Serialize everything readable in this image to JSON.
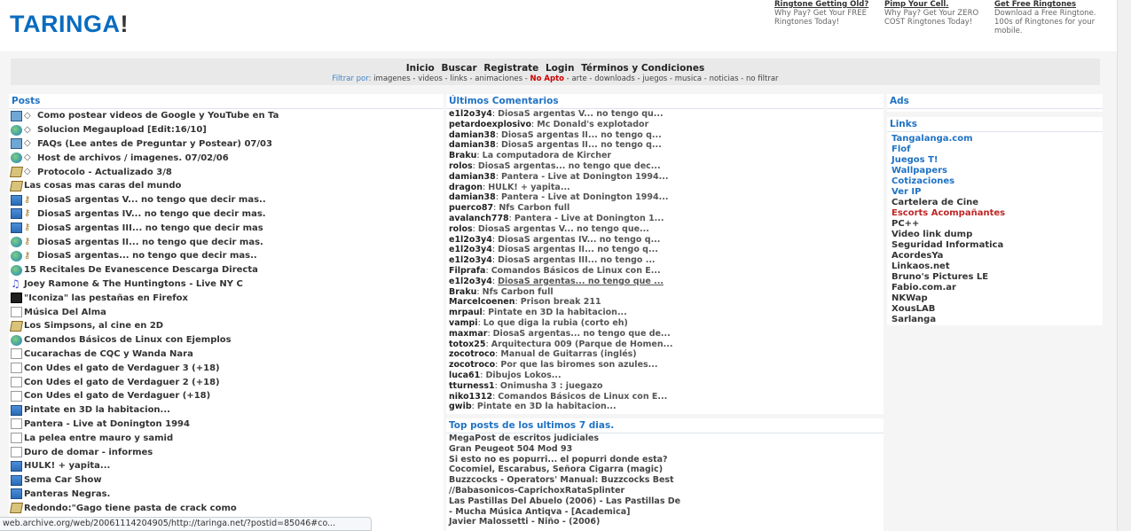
{
  "logo": {
    "text": "TARINGA",
    "bang": "!"
  },
  "top_ads": [
    {
      "title": "Ringtone Getting Old?",
      "desc1": "Why Pay? Get Your FREE",
      "desc2": "Ringtones Today!",
      "desc3": ""
    },
    {
      "title": "Pimp Your Cell.",
      "desc1": "Why Pay? Get Your ZERO",
      "desc2": "COST Ringtones Today!",
      "desc3": ""
    },
    {
      "title": "Get Free Ringtones",
      "desc1": "Download a Free Ringtone.",
      "desc2": "100s of Ringtones for your",
      "desc3": "mobile."
    }
  ],
  "nav": {
    "links": [
      "Inicio",
      "Buscar",
      "Registrate",
      "Login",
      "Términos y Condiciones"
    ],
    "filter_label": "Filtrar por:",
    "filters": [
      "imagenes",
      "videos",
      "links",
      "animaciones"
    ],
    "noapto": "No Apto",
    "filters2": [
      "arte",
      "downloads",
      "juegos",
      "musica",
      "noticias",
      "no filtrar"
    ]
  },
  "posts": {
    "title": "Posts",
    "items": [
      {
        "icon": "cat",
        "sticky": true,
        "text": "Como postear videos de Google y YouTube en Ta"
      },
      {
        "icon": "globe",
        "sticky": true,
        "text": "Solucion Megaupload [Edit:16/10]"
      },
      {
        "icon": "cat",
        "sticky": true,
        "text": "FAQs (Lee antes de Preguntar y Postear) 07/03"
      },
      {
        "icon": "globe",
        "sticky": true,
        "text": "Host de archivos / imagenes. 07/02/06"
      },
      {
        "icon": "book",
        "sticky": true,
        "text": "Protocolo - Actualizado 3/8"
      },
      {
        "icon": "book",
        "sticky": false,
        "text": "Las cosas mas caras del mundo"
      },
      {
        "icon": "img",
        "pin": true,
        "text": "DiosaS argentas V... no tengo que decir mas.."
      },
      {
        "icon": "img",
        "pin": true,
        "text": "DiosaS argentas IV... no tengo que decir mas."
      },
      {
        "icon": "img",
        "pin": true,
        "text": "DiosaS argentas III... no tengo que decir mas"
      },
      {
        "icon": "globe",
        "pin": true,
        "text": "DiosaS argentas II... no tengo que decir mas."
      },
      {
        "icon": "globe",
        "pin": true,
        "text": "DiosaS argentas... no tengo que decir mas.."
      },
      {
        "icon": "globe",
        "text": "15 Recitales De Evanescence Descarga Directa"
      },
      {
        "icon": "music",
        "text": "Joey Ramone & The Huntingtons - Live NY C"
      },
      {
        "icon": "vid",
        "text": "\"Iconiza\" las pestañas en Firefox"
      },
      {
        "icon": "note",
        "text": "Música Del Alma"
      },
      {
        "icon": "book",
        "text": "Los Simpsons, al cine en 2D"
      },
      {
        "icon": "globe",
        "text": "Comandos Básicos de Linux con Ejemplos"
      },
      {
        "icon": "note",
        "text": "Cucarachas de CQC y Wanda Nara"
      },
      {
        "icon": "note",
        "text": "Con Udes el gato de Verdaguer 3 (+18)"
      },
      {
        "icon": "note",
        "text": "Con Udes el gato de Verdaguer 2 (+18)"
      },
      {
        "icon": "note",
        "text": "Con Udes el gato de Verdaguer (+18)"
      },
      {
        "icon": "img",
        "text": "Pintate en 3D la habitacion..."
      },
      {
        "icon": "note",
        "text": "Pantera - Live at Donington 1994"
      },
      {
        "icon": "note",
        "text": "La pelea entre mauro y samid"
      },
      {
        "icon": "note",
        "text": "Duro de domar - informes"
      },
      {
        "icon": "img",
        "text": "HULK! + yapita..."
      },
      {
        "icon": "img",
        "text": "Sema Car Show"
      },
      {
        "icon": "img",
        "text": "Panteras Negras."
      },
      {
        "icon": "book",
        "text": "Redondo:\"Gago tiene pasta de crack como"
      }
    ]
  },
  "comments": {
    "title": "Últimos Comentarios",
    "items": [
      {
        "user": "e1l2o3y4",
        "text": "DiosaS argentas V... no tengo qu..."
      },
      {
        "user": "petardoexplosivo",
        "text": "Mc Donald's explotador"
      },
      {
        "user": "damian38",
        "text": "DiosaS argentas II... no tengo q..."
      },
      {
        "user": "damian38",
        "text": "DiosaS argentas II... no tengo q..."
      },
      {
        "user": "Braku",
        "text": "La computadora de Kircher"
      },
      {
        "user": "rolos",
        "text": "DiosaS argentas... no tengo que dec..."
      },
      {
        "user": "damian38",
        "text": "Pantera - Live at Donington 1994..."
      },
      {
        "user": "dragon",
        "text": "HULK! + yapita..."
      },
      {
        "user": "damian38",
        "text": "Pantera - Live at Donington 1994..."
      },
      {
        "user": "puerco87",
        "text": "Nfs Carbon full"
      },
      {
        "user": "avalanch778",
        "text": "Pantera - Live at Donington 1..."
      },
      {
        "user": "rolos",
        "text": "DiosaS argentas V... no tengo que..."
      },
      {
        "user": "e1l2o3y4",
        "text": "DiosaS argentas IV... no tengo q..."
      },
      {
        "user": "e1l2o3y4",
        "text": "DiosaS argentas II... no tengo q..."
      },
      {
        "user": "e1l2o3y4",
        "text": "DiosaS argentas III... no tengo ..."
      },
      {
        "user": "Filprafa",
        "text": "Comandos Básicos de Linux con E..."
      },
      {
        "user": "e1l2o3y4",
        "text": "DiosaS argentas... no tengo que ...",
        "underline": true
      },
      {
        "user": "Braku",
        "text": "Nfs Carbon full"
      },
      {
        "user": "Marcelcoenen",
        "text": "Prison break 211"
      },
      {
        "user": "mrpaul",
        "text": "Pintate en 3D la habitacion..."
      },
      {
        "user": "vampi",
        "text": "Lo que diga la rubia (corto eh)"
      },
      {
        "user": "maxmar",
        "text": "DiosaS argentas... no tengo que de..."
      },
      {
        "user": "totox25",
        "text": "Arquitectura 009 (Parque de Homen..."
      },
      {
        "user": "zocotroco",
        "text": "Manual de Guitarras (inglés)"
      },
      {
        "user": "zocotroco",
        "text": "Por que las biromes son azules..."
      },
      {
        "user": "luca61",
        "text": "Dibujos Lokos..."
      },
      {
        "user": "tturness1",
        "text": "Onimusha 3 : juegazo"
      },
      {
        "user": "niko1312",
        "text": "Comandos Básicos de Linux con E..."
      },
      {
        "user": "gwib",
        "text": "Pintate en 3D la habitacion..."
      }
    ]
  },
  "top_posts": {
    "title": "Top posts de los ultimos 7 dias.",
    "items": [
      "MegaPost de escritos judiciales",
      "Gran Peugeot 504 Mod 93",
      "Si esto no es popurri... el popurri donde esta?",
      "Cocomiel, Escarabus, Señora Cigarra (magic)",
      "Buzzcocks - Operators' Manual: Buzzcocks Best",
      "//Babasonicos-CaprichoxRataSplinter",
      "Las Pastillas Del Abuelo (2006) - Las Pastillas De",
      "- Mucha Música Antiqva - [Academica]",
      "Javier Malossetti - Niño - (2006)"
    ]
  },
  "ads_box": {
    "title": "Ads"
  },
  "links": {
    "title": "Links",
    "items": [
      {
        "text": "Tangalanga.com",
        "style": "blue"
      },
      {
        "text": "Flof",
        "style": "blue"
      },
      {
        "text": "Juegos T!",
        "style": "blue"
      },
      {
        "text": "Wallpapers",
        "style": "blue"
      },
      {
        "text": "Cotizaciones",
        "style": "blue"
      },
      {
        "text": "Ver IP",
        "style": "blue"
      },
      {
        "text": "Cartelera de Cine",
        "style": "dark"
      },
      {
        "text": "Escorts Acompañantes",
        "style": "red"
      },
      {
        "text": "PC++",
        "style": "dark"
      },
      {
        "text": "Video link dump",
        "style": "dark"
      },
      {
        "text": "Seguridad Informatica",
        "style": "dark"
      },
      {
        "text": "AcordesYa",
        "style": "dark"
      },
      {
        "text": "Linkaos.net",
        "style": "dark"
      },
      {
        "text": "Bruno's Pictures LE",
        "style": "dark"
      },
      {
        "text": "Fabio.com.ar",
        "style": "dark"
      },
      {
        "text": "NKWap",
        "style": "dark"
      },
      {
        "text": "XousLAB",
        "style": "dark"
      },
      {
        "text": "Sarlanga",
        "style": "dark"
      }
    ]
  },
  "status_bar": {
    "url": "web.archive.org/web/20061114204905/http://taringa.net/?postid=85046#co..."
  }
}
